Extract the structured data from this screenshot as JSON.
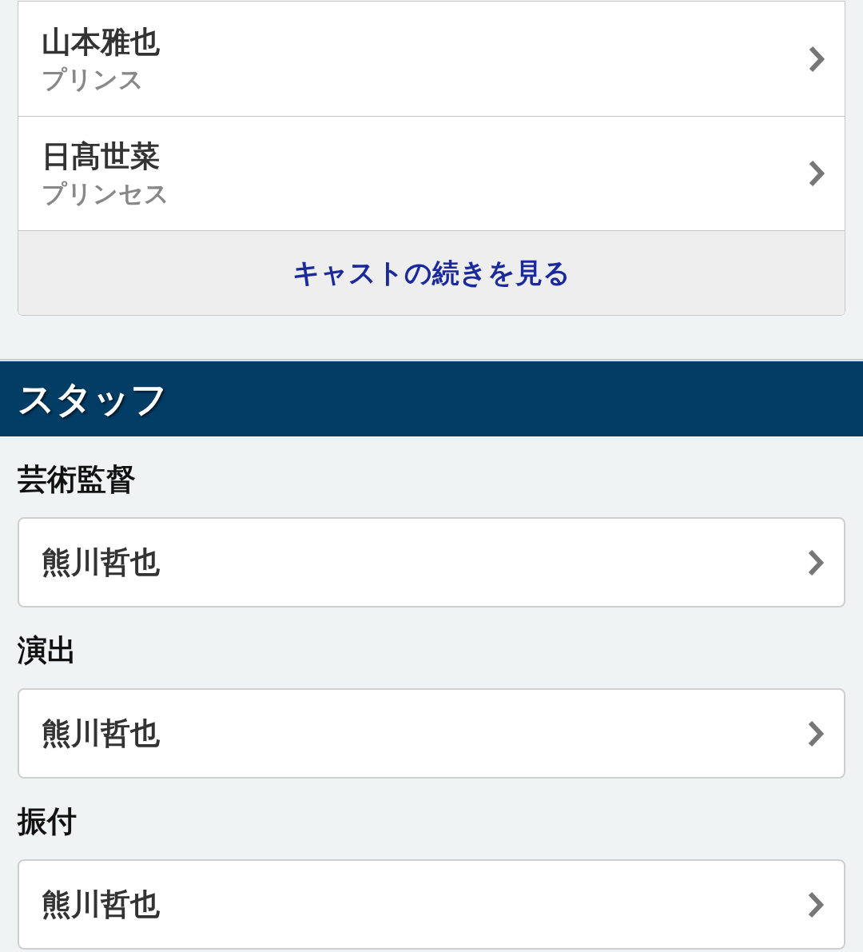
{
  "cast": [
    {
      "name": "山本雅也",
      "role": "プリンス"
    },
    {
      "name": "日髙世菜",
      "role": "プリンセス"
    }
  ],
  "more_button": "キャストの続きを見る",
  "staff": {
    "title": "スタッフ",
    "groups": [
      {
        "heading": "芸術監督",
        "members": [
          "熊川哲也"
        ]
      },
      {
        "heading": "演出",
        "members": [
          "熊川哲也"
        ]
      },
      {
        "heading": "振付",
        "members": [
          "熊川哲也"
        ]
      }
    ]
  }
}
